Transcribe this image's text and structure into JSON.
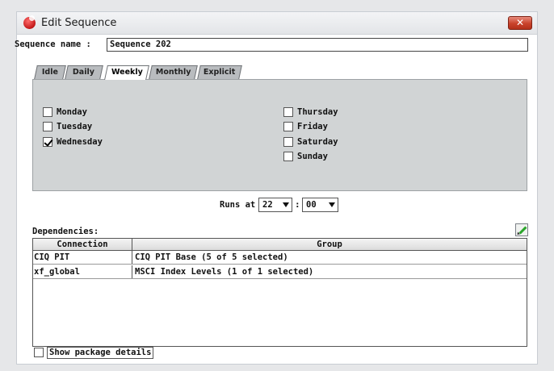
{
  "window": {
    "title": "Edit Sequence",
    "close_label": "✕"
  },
  "sequence": {
    "name_label": "Sequence name :",
    "name_value": "Sequence 202"
  },
  "tabs": [
    {
      "label": "Idle",
      "active": false
    },
    {
      "label": "Daily",
      "active": false
    },
    {
      "label": "Weekly",
      "active": true
    },
    {
      "label": "Monthly",
      "active": false
    },
    {
      "label": "Explicit",
      "active": false
    }
  ],
  "days": [
    {
      "label": "Monday",
      "checked": false
    },
    {
      "label": "Tuesday",
      "checked": false
    },
    {
      "label": "Wednesday",
      "checked": true
    },
    {
      "label": "Thursday",
      "checked": false
    },
    {
      "label": "Friday",
      "checked": false
    },
    {
      "label": "Saturday",
      "checked": false
    },
    {
      "label": "Sunday",
      "checked": false
    }
  ],
  "runs_at": {
    "label": "Runs at",
    "hour": "22",
    "separator": ":",
    "minute": "00"
  },
  "dependencies": {
    "label": "Dependencies:",
    "edit_icon": "pencil-icon",
    "columns": [
      "Connection",
      "Group"
    ],
    "rows": [
      {
        "connection": "CIQ PIT",
        "group": "CIQ PIT Base (5 of 5 selected)"
      },
      {
        "connection": "xf_global",
        "group": "MSCI Index Levels (1 of 1 selected)"
      }
    ]
  },
  "show_details": {
    "label": "Show package details",
    "checked": false
  },
  "colors": {
    "panel_bg": "#d1d4d5",
    "tab_bg": "#b9bcbf",
    "close_red": "#c9422b",
    "page_bg": "#e6e7e9"
  }
}
